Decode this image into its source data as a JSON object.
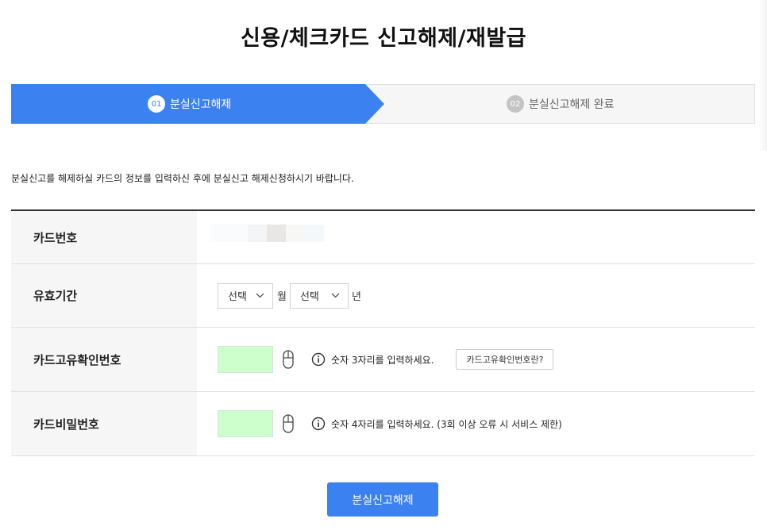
{
  "page": {
    "title": "신용/체크카드 신고해제/재발급"
  },
  "steps": [
    {
      "number": "01",
      "label": "분실신고해제",
      "active": true
    },
    {
      "number": "02",
      "label": "분실신고해제 완료",
      "active": false
    }
  ],
  "colors": {
    "accent": "#3b82f0",
    "secure_input": "#ccffcc"
  },
  "guide_text": "분실신고를 해제하실 카드의 정보를 입력하신 후에 분실신고 해제신청하시기 바랍니다.",
  "form": {
    "card_number": {
      "label": "카드번호",
      "value_masked": true
    },
    "expiry": {
      "label": "유효기간",
      "month_select": "선택",
      "month_unit": "월",
      "year_select": "선택",
      "year_unit": "년"
    },
    "cvc": {
      "label": "카드고유확인번호",
      "hint": "숫자 3자리를 입력하세요.",
      "help_button": "카드고유확인번호란?"
    },
    "password": {
      "label": "카드비밀번호",
      "hint": "숫자 4자리를 입력하세요. (3회 이상 오류 시 서비스 제한)"
    }
  },
  "submit_label": "분실신고해제",
  "icons": [
    "chevron-down-icon",
    "mouse-icon",
    "info-icon"
  ]
}
